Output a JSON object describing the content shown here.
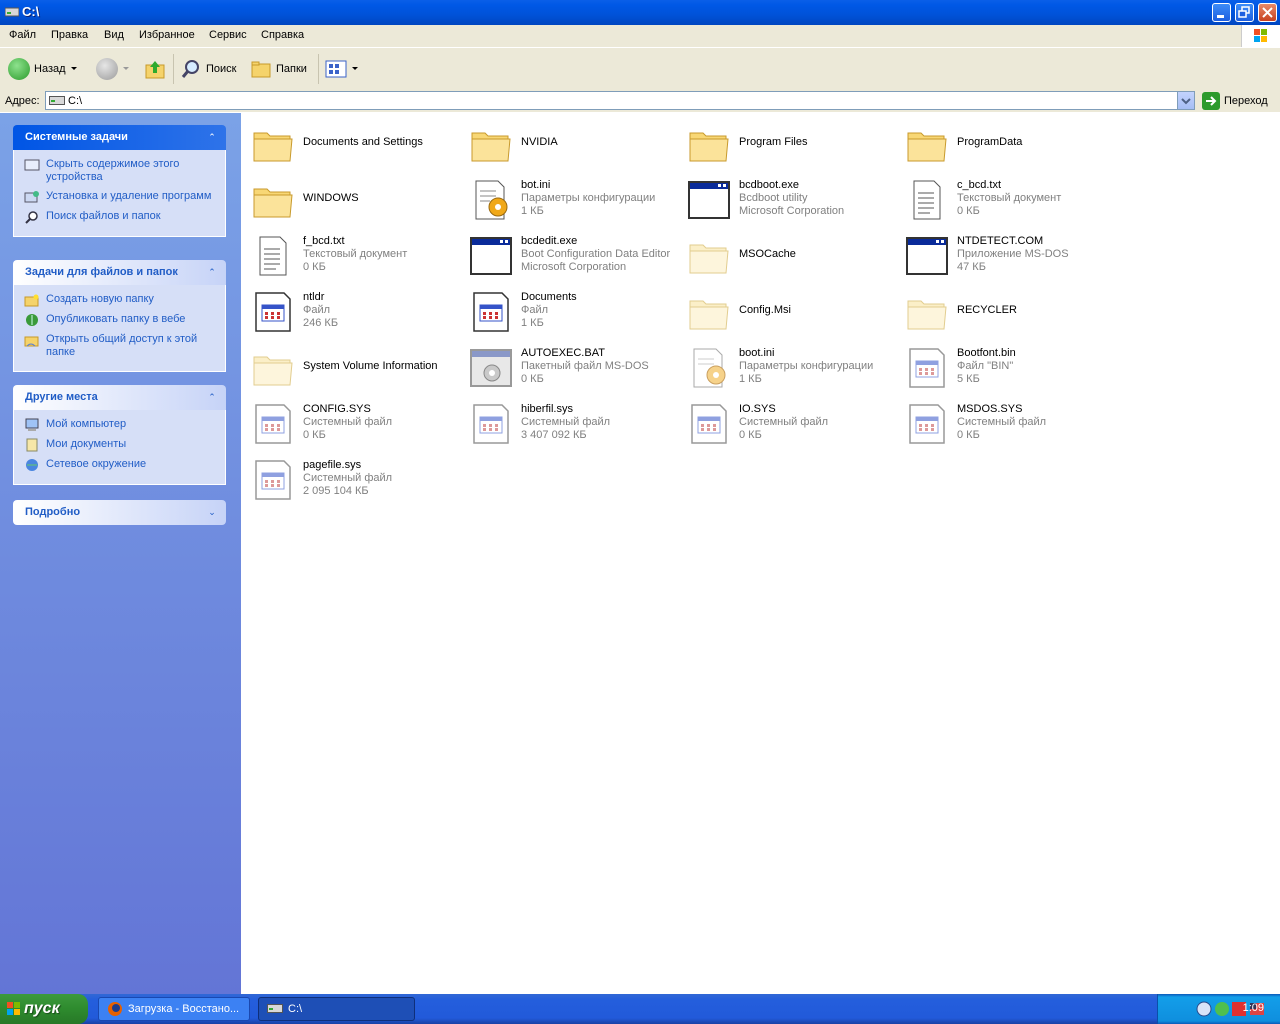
{
  "window": {
    "title": "C:\\"
  },
  "menu": [
    "Файл",
    "Правка",
    "Вид",
    "Избранное",
    "Сервис",
    "Справка"
  ],
  "toolbar": {
    "back": "Назад",
    "search": "Поиск",
    "folders": "Папки"
  },
  "address": {
    "label": "Адрес:",
    "value": "C:\\",
    "go": "Переход"
  },
  "left": {
    "system_tasks": {
      "title": "Системные задачи",
      "items": [
        "Скрыть содержимое этого устройства",
        "Установка и удаление программ",
        "Поиск файлов и папок"
      ]
    },
    "file_tasks": {
      "title": "Задачи для файлов и папок",
      "items": [
        "Создать новую папку",
        "Опубликовать папку в вебе",
        "Открыть общий доступ к этой папке"
      ]
    },
    "other_places": {
      "title": "Другие места",
      "items": [
        "Мой компьютер",
        "Мои документы",
        "Сетевое окружение"
      ]
    },
    "details": {
      "title": "Подробно"
    }
  },
  "files": [
    {
      "name": "Documents and Settings",
      "line2": "",
      "line3": "",
      "icon": "folder"
    },
    {
      "name": "NVIDIA",
      "line2": "",
      "line3": "",
      "icon": "folder"
    },
    {
      "name": "Program Files",
      "line2": "",
      "line3": "",
      "icon": "folder"
    },
    {
      "name": "ProgramData",
      "line2": "",
      "line3": "",
      "icon": "folder"
    },
    {
      "name": "WINDOWS",
      "line2": "",
      "line3": "",
      "icon": "folder"
    },
    {
      "name": "bot.ini",
      "line2": "Параметры конфигурации",
      "line3": "1 КБ",
      "icon": "ini"
    },
    {
      "name": "bcdboot.exe",
      "line2": "Bcdboot utility",
      "line3": "Microsoft Corporation",
      "icon": "exe"
    },
    {
      "name": "c_bcd.txt",
      "line2": "Текстовый документ",
      "line3": "0 КБ",
      "icon": "txt"
    },
    {
      "name": "f_bcd.txt",
      "line2": "Текстовый документ",
      "line3": "0 КБ",
      "icon": "txt"
    },
    {
      "name": "bcdedit.exe",
      "line2": "Boot Configuration Data Editor",
      "line3": "Microsoft Corporation",
      "icon": "exe"
    },
    {
      "name": "MSOCache",
      "line2": "",
      "line3": "",
      "icon": "folder-hidden"
    },
    {
      "name": "NTDETECT.COM",
      "line2": "Приложение MS-DOS",
      "line3": "47 КБ",
      "icon": "exe"
    },
    {
      "name": "ntldr",
      "line2": "Файл",
      "line3": "246 КБ",
      "icon": "sys"
    },
    {
      "name": "Documents",
      "line2": "Файл",
      "line3": "1 КБ",
      "icon": "sys"
    },
    {
      "name": "Config.Msi",
      "line2": "",
      "line3": "",
      "icon": "folder-hidden"
    },
    {
      "name": "RECYCLER",
      "line2": "",
      "line3": "",
      "icon": "folder-hidden"
    },
    {
      "name": "System Volume Information",
      "line2": "",
      "line3": "",
      "icon": "folder-hidden"
    },
    {
      "name": "AUTOEXEC.BAT",
      "line2": "Пакетный файл MS-DOS",
      "line3": "0 КБ",
      "icon": "bat"
    },
    {
      "name": "boot.ini",
      "line2": "Параметры конфигурации",
      "line3": "1 КБ",
      "icon": "ini-hidden"
    },
    {
      "name": "Bootfont.bin",
      "line2": "Файл \"BIN\"",
      "line3": "5 КБ",
      "icon": "sys-hidden"
    },
    {
      "name": "CONFIG.SYS",
      "line2": "Системный файл",
      "line3": "0 КБ",
      "icon": "sys-hidden"
    },
    {
      "name": "hiberfil.sys",
      "line2": "Системный файл",
      "line3": "3 407 092 КБ",
      "icon": "sys-hidden"
    },
    {
      "name": "IO.SYS",
      "line2": "Системный файл",
      "line3": "0 КБ",
      "icon": "sys-hidden"
    },
    {
      "name": "MSDOS.SYS",
      "line2": "Системный файл",
      "line3": "0 КБ",
      "icon": "sys-hidden"
    },
    {
      "name": "pagefile.sys",
      "line2": "Системный файл",
      "line3": "2 095 104 КБ",
      "icon": "sys-hidden"
    }
  ],
  "taskbar": {
    "start": "пуск",
    "tasks": [
      "Загрузка - Восстано...",
      "C:\\"
    ],
    "clock": "1:09"
  }
}
